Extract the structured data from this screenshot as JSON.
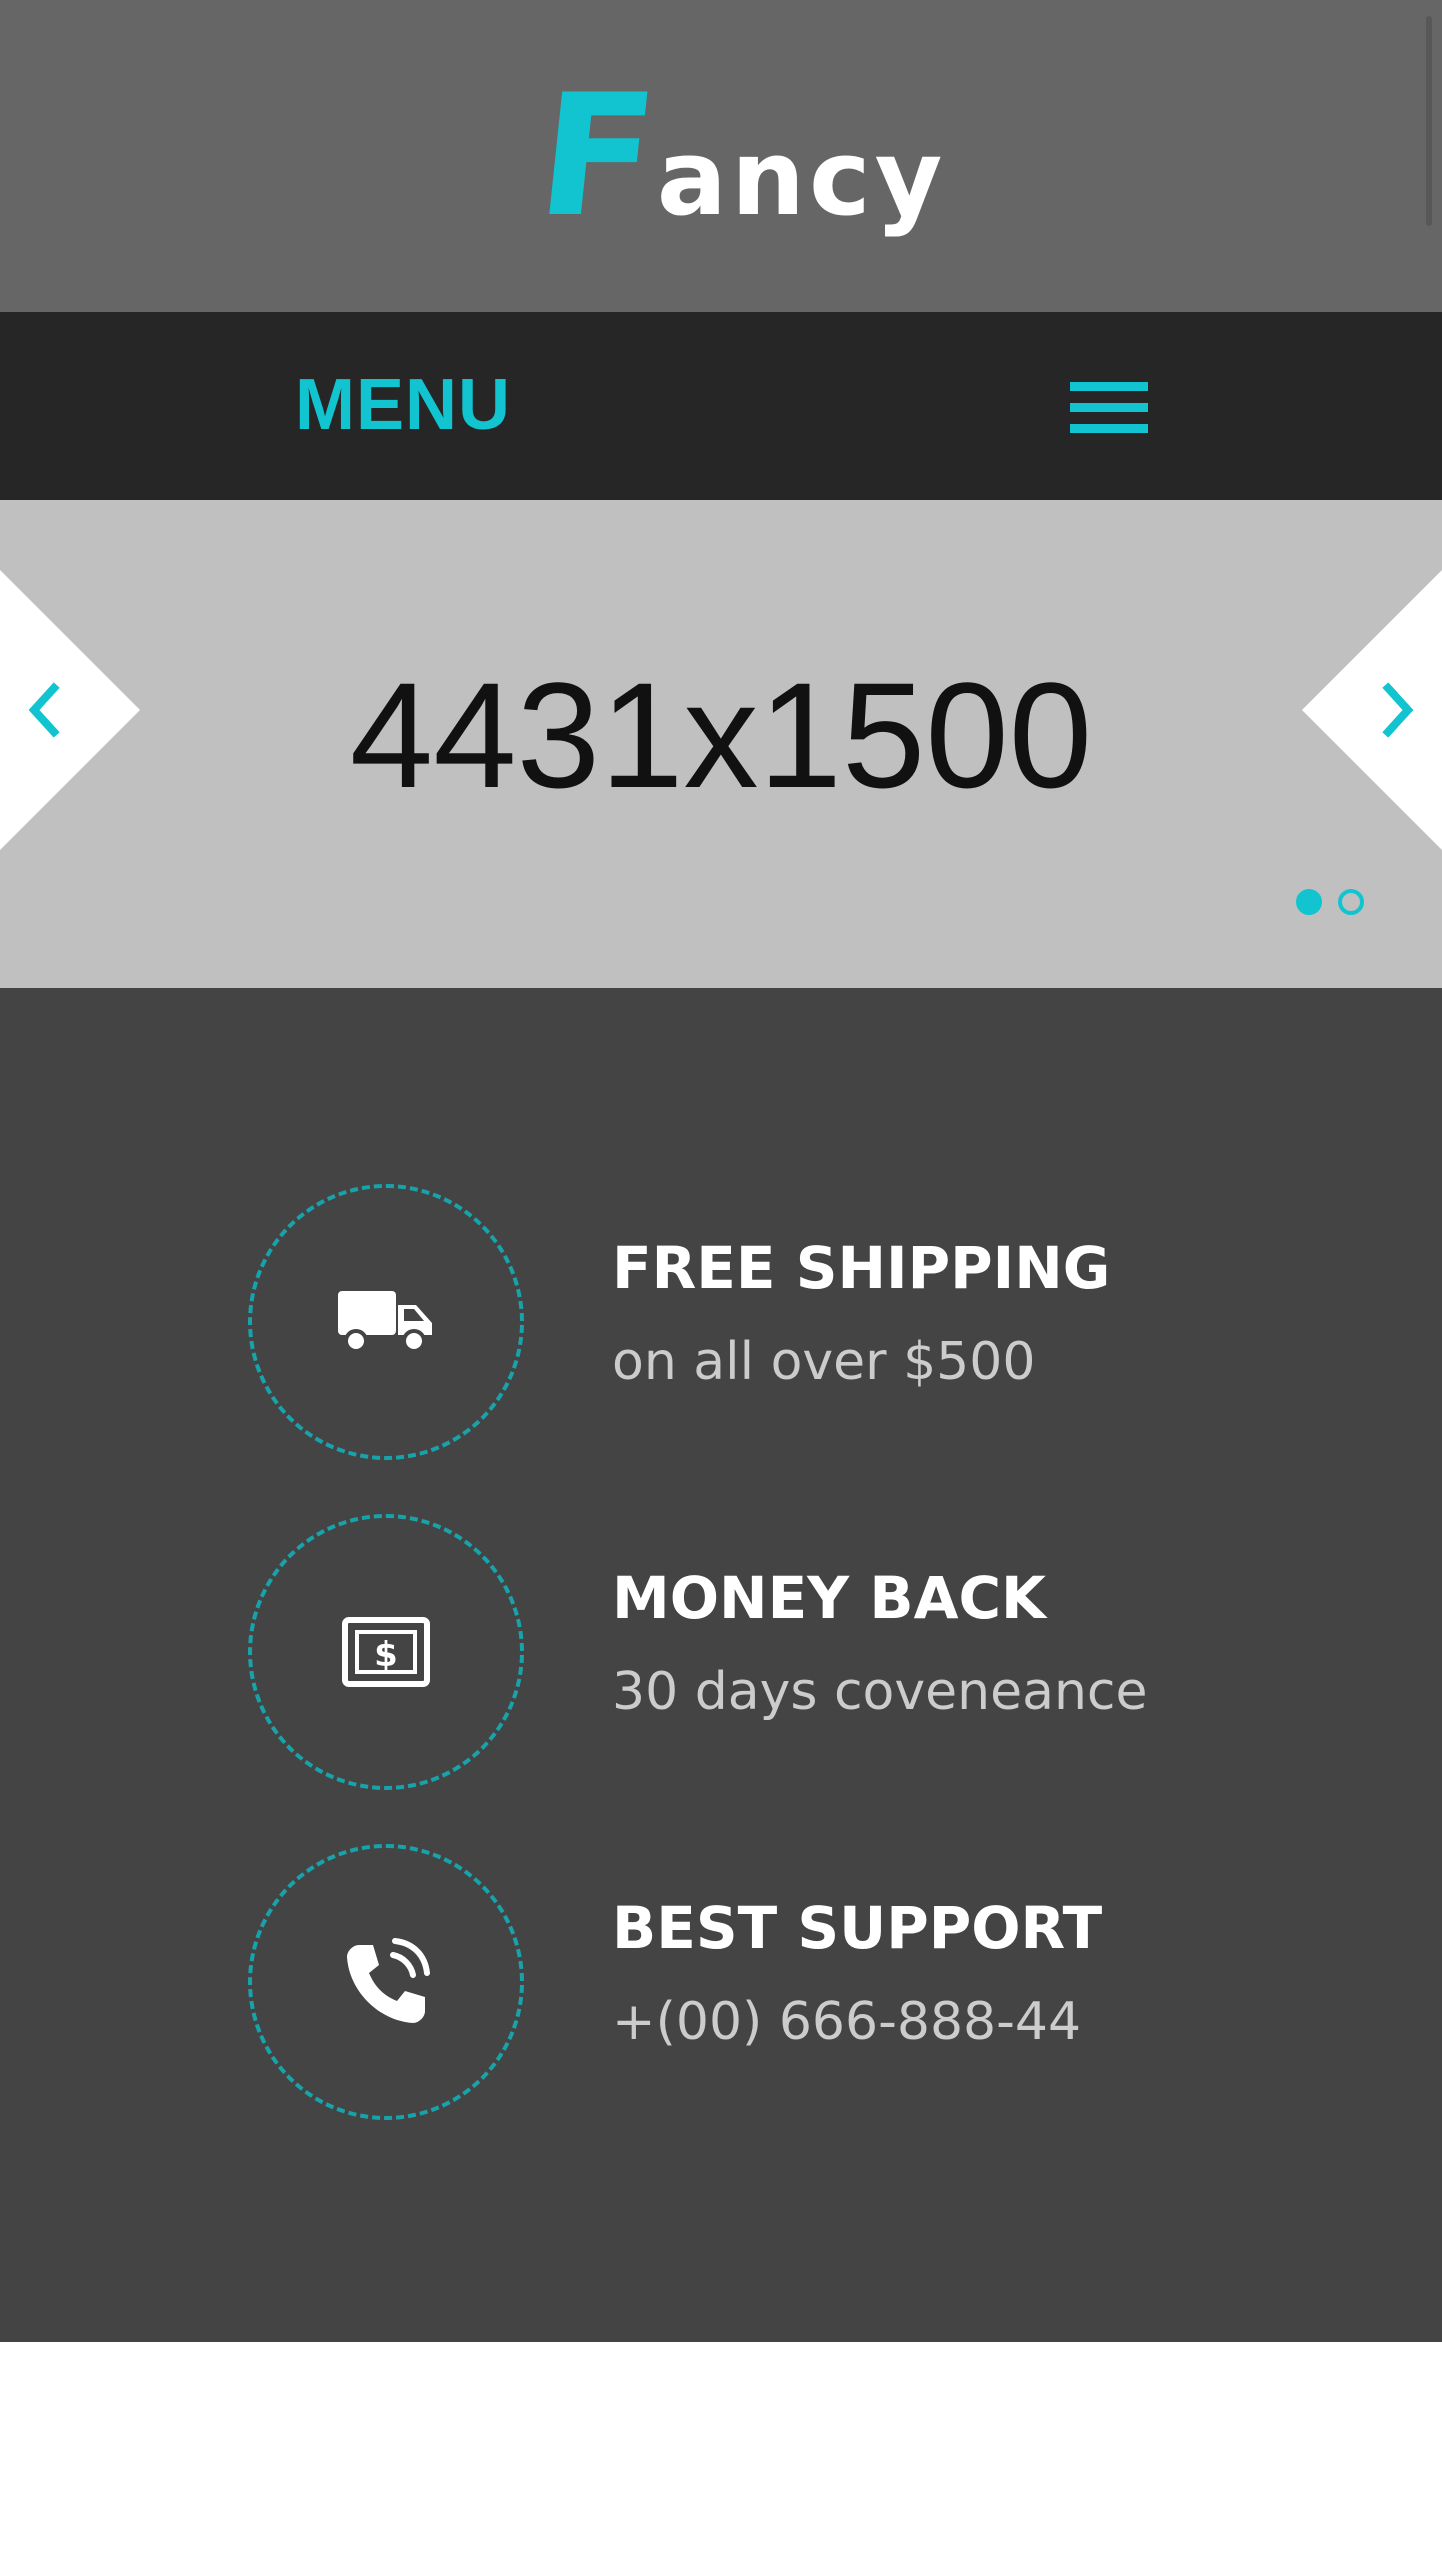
{
  "header": {
    "logo_initial": "F",
    "logo_rest": "ancy"
  },
  "nav": {
    "menu_label": "MENU"
  },
  "slider": {
    "placeholder_text": "4431x1500",
    "active_slide": 1,
    "total_slides": 2
  },
  "features": [
    {
      "icon": "truck-icon",
      "title": "FREE SHIPPING",
      "subtitle": "on all over $500"
    },
    {
      "icon": "money-icon",
      "title": "MONEY BACK",
      "subtitle": "30 days coveneance"
    },
    {
      "icon": "phone-icon",
      "title": "BEST SUPPORT",
      "subtitle": "+(00) 666-888-44"
    }
  ],
  "colors": {
    "accent": "#11c4cf",
    "header_bg": "#666666",
    "menubar_bg": "#262626",
    "slider_bg": "#c0c0c0",
    "features_bg": "#444444"
  }
}
